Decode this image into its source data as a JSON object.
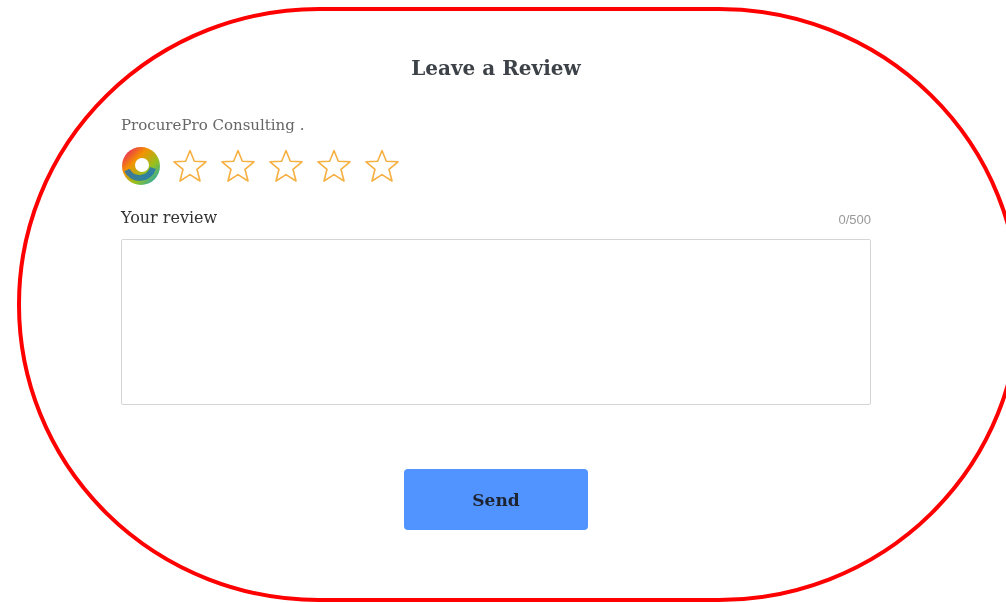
{
  "title": "Leave a Review",
  "company": {
    "name": "ProcurePro Consulting .",
    "stars": 0
  },
  "review": {
    "label": "Your review",
    "counter": "0/500"
  },
  "send_button": "Send",
  "annotation": {
    "kind": "outline",
    "color": "#ff0000"
  }
}
